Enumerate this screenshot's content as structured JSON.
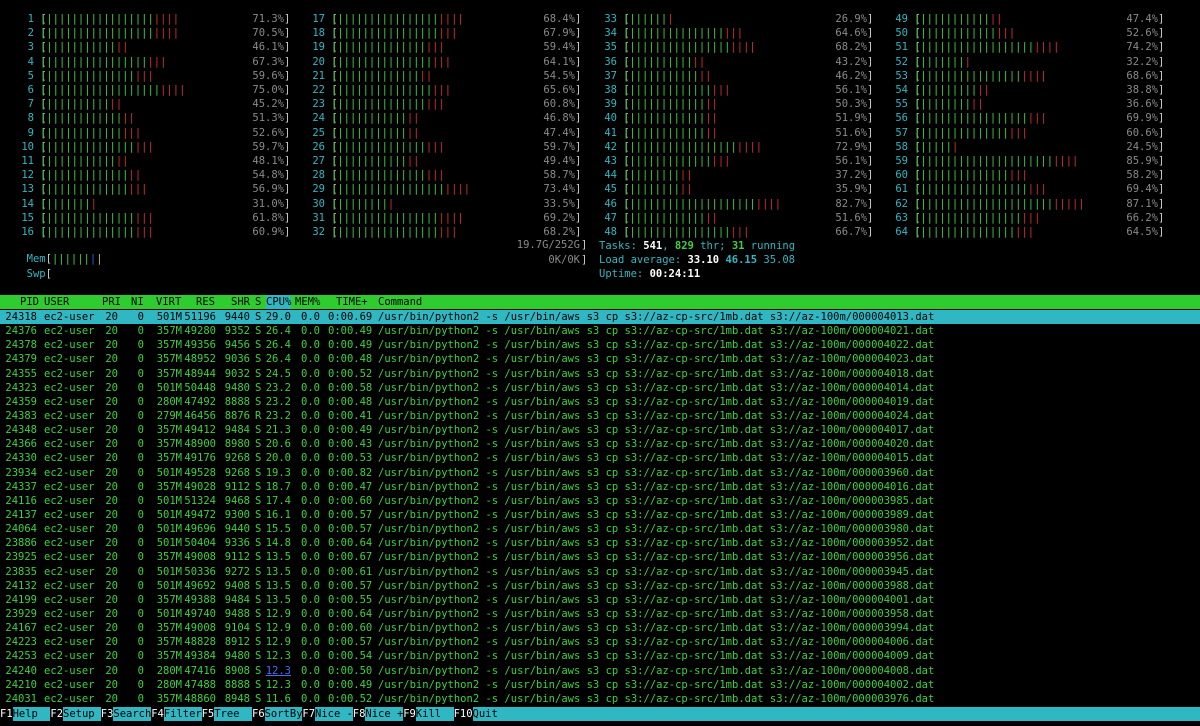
{
  "cpus": [
    {
      "id": "1",
      "pct": "71.3%",
      "g": 18,
      "r": 4
    },
    {
      "id": "2",
      "pct": "70.5%",
      "g": 18,
      "r": 4
    },
    {
      "id": "3",
      "pct": "46.1%",
      "g": 12,
      "r": 2
    },
    {
      "id": "4",
      "pct": "67.3%",
      "g": 17,
      "r": 3
    },
    {
      "id": "5",
      "pct": "59.6%",
      "g": 15,
      "r": 3
    },
    {
      "id": "6",
      "pct": "75.0%",
      "g": 19,
      "r": 4
    },
    {
      "id": "7",
      "pct": "45.2%",
      "g": 11,
      "r": 2
    },
    {
      "id": "8",
      "pct": "51.3%",
      "g": 13,
      "r": 2
    },
    {
      "id": "9",
      "pct": "52.6%",
      "g": 13,
      "r": 3
    },
    {
      "id": "10",
      "pct": "59.7%",
      "g": 15,
      "r": 3
    },
    {
      "id": "11",
      "pct": "48.1%",
      "g": 12,
      "r": 2
    },
    {
      "id": "12",
      "pct": "54.8%",
      "g": 14,
      "r": 2
    },
    {
      "id": "13",
      "pct": "56.9%",
      "g": 14,
      "r": 3
    },
    {
      "id": "14",
      "pct": "31.0%",
      "g": 8,
      "r": 1
    },
    {
      "id": "15",
      "pct": "61.8%",
      "g": 15,
      "r": 3
    },
    {
      "id": "16",
      "pct": "60.9%",
      "g": 15,
      "r": 3
    },
    {
      "id": "17",
      "pct": "68.4%",
      "g": 17,
      "r": 4
    },
    {
      "id": "18",
      "pct": "67.9%",
      "g": 17,
      "r": 3
    },
    {
      "id": "19",
      "pct": "59.4%",
      "g": 15,
      "r": 3
    },
    {
      "id": "20",
      "pct": "64.1%",
      "g": 16,
      "r": 3
    },
    {
      "id": "21",
      "pct": "54.5%",
      "g": 14,
      "r": 2
    },
    {
      "id": "22",
      "pct": "65.6%",
      "g": 16,
      "r": 3
    },
    {
      "id": "23",
      "pct": "60.8%",
      "g": 15,
      "r": 3
    },
    {
      "id": "24",
      "pct": "46.8%",
      "g": 12,
      "r": 2
    },
    {
      "id": "25",
      "pct": "47.4%",
      "g": 12,
      "r": 2
    },
    {
      "id": "26",
      "pct": "59.7%",
      "g": 15,
      "r": 3
    },
    {
      "id": "27",
      "pct": "49.4%",
      "g": 12,
      "r": 2
    },
    {
      "id": "28",
      "pct": "58.7%",
      "g": 15,
      "r": 3
    },
    {
      "id": "29",
      "pct": "73.4%",
      "g": 18,
      "r": 4
    },
    {
      "id": "30",
      "pct": "33.5%",
      "g": 9,
      "r": 1
    },
    {
      "id": "31",
      "pct": "69.2%",
      "g": 17,
      "r": 4
    },
    {
      "id": "32",
      "pct": "68.2%",
      "g": 17,
      "r": 3
    },
    {
      "id": "33",
      "pct": "26.9%",
      "g": 7,
      "r": 1
    },
    {
      "id": "34",
      "pct": "64.6%",
      "g": 16,
      "r": 3
    },
    {
      "id": "35",
      "pct": "68.2%",
      "g": 17,
      "r": 4
    },
    {
      "id": "36",
      "pct": "43.2%",
      "g": 11,
      "r": 2
    },
    {
      "id": "37",
      "pct": "46.2%",
      "g": 12,
      "r": 2
    },
    {
      "id": "38",
      "pct": "56.1%",
      "g": 14,
      "r": 3
    },
    {
      "id": "39",
      "pct": "50.3%",
      "g": 13,
      "r": 2
    },
    {
      "id": "40",
      "pct": "51.9%",
      "g": 13,
      "r": 2
    },
    {
      "id": "41",
      "pct": "51.6%",
      "g": 13,
      "r": 2
    },
    {
      "id": "42",
      "pct": "72.9%",
      "g": 18,
      "r": 4
    },
    {
      "id": "43",
      "pct": "56.1%",
      "g": 14,
      "r": 3
    },
    {
      "id": "44",
      "pct": "37.2%",
      "g": 9,
      "r": 2
    },
    {
      "id": "45",
      "pct": "35.9%",
      "g": 9,
      "r": 2
    },
    {
      "id": "46",
      "pct": "82.7%",
      "g": 21,
      "r": 4
    },
    {
      "id": "47",
      "pct": "51.6%",
      "g": 13,
      "r": 2
    },
    {
      "id": "48",
      "pct": "66.7%",
      "g": 17,
      "r": 3
    },
    {
      "id": "49",
      "pct": "47.4%",
      "g": 12,
      "r": 2
    },
    {
      "id": "50",
      "pct": "52.6%",
      "g": 13,
      "r": 3
    },
    {
      "id": "51",
      "pct": "74.2%",
      "g": 19,
      "r": 4
    },
    {
      "id": "52",
      "pct": "32.2%",
      "g": 8,
      "r": 1
    },
    {
      "id": "53",
      "pct": "68.6%",
      "g": 17,
      "r": 4
    },
    {
      "id": "54",
      "pct": "38.8%",
      "g": 10,
      "r": 2
    },
    {
      "id": "55",
      "pct": "36.6%",
      "g": 9,
      "r": 2
    },
    {
      "id": "56",
      "pct": "69.9%",
      "g": 18,
      "r": 3
    },
    {
      "id": "57",
      "pct": "60.6%",
      "g": 15,
      "r": 3
    },
    {
      "id": "58",
      "pct": "24.5%",
      "g": 6,
      "r": 1
    },
    {
      "id": "59",
      "pct": "85.9%",
      "g": 22,
      "r": 4
    },
    {
      "id": "60",
      "pct": "58.2%",
      "g": 15,
      "r": 3
    },
    {
      "id": "61",
      "pct": "69.4%",
      "g": 18,
      "r": 3
    },
    {
      "id": "62",
      "pct": "87.1%",
      "g": 22,
      "r": 5
    },
    {
      "id": "63",
      "pct": "66.2%",
      "g": 17,
      "r": 3
    },
    {
      "id": "64",
      "pct": "64.5%",
      "g": 16,
      "r": 3
    }
  ],
  "mem": {
    "label": "Mem",
    "value": "19.7G/252G"
  },
  "swp": {
    "label": "Swp",
    "value": "0K/0K"
  },
  "tasks": {
    "label": "Tasks:",
    "count": "541",
    "sep": ",",
    "thr": "829",
    "thr_label": "thr;",
    "running": "31",
    "running_label": "running"
  },
  "load": {
    "label": "Load average:",
    "l1": "33.10",
    "l5": "46.15",
    "l15": "35.08"
  },
  "uptime": {
    "label": "Uptime:",
    "value": "00:24:11"
  },
  "columns": {
    "pid": "PID",
    "user": "USER",
    "pri": "PRI",
    "ni": "NI",
    "virt": "VIRT",
    "res": "RES",
    "shr": "SHR",
    "s": "S",
    "cpu": "CPU%",
    "mem": "MEM%",
    "time": "TIME+",
    "cmd": "Command"
  },
  "processes": [
    {
      "pid": "24318",
      "user": "ec2-user",
      "pri": "20",
      "ni": "0",
      "virt": "501M",
      "res": "51196",
      "shr": "9440",
      "s": "S",
      "cpu": "29.0",
      "mem": "0.0",
      "time": "0:00.69",
      "cmd": "/usr/bin/python2 -s /usr/bin/aws s3 cp s3://az-cp-src/1mb.dat s3://az-100m/000004013.dat"
    },
    {
      "pid": "24376",
      "user": "ec2-user",
      "pri": "20",
      "ni": "0",
      "virt": "357M",
      "res": "49280",
      "shr": "9352",
      "s": "S",
      "cpu": "26.4",
      "mem": "0.0",
      "time": "0:00.49",
      "cmd": "/usr/bin/python2 -s /usr/bin/aws s3 cp s3://az-cp-src/1mb.dat s3://az-100m/000004021.dat"
    },
    {
      "pid": "24378",
      "user": "ec2-user",
      "pri": "20",
      "ni": "0",
      "virt": "357M",
      "res": "49356",
      "shr": "9456",
      "s": "S",
      "cpu": "26.4",
      "mem": "0.0",
      "time": "0:00.49",
      "cmd": "/usr/bin/python2 -s /usr/bin/aws s3 cp s3://az-cp-src/1mb.dat s3://az-100m/000004022.dat"
    },
    {
      "pid": "24379",
      "user": "ec2-user",
      "pri": "20",
      "ni": "0",
      "virt": "357M",
      "res": "48952",
      "shr": "9036",
      "s": "S",
      "cpu": "26.4",
      "mem": "0.0",
      "time": "0:00.48",
      "cmd": "/usr/bin/python2 -s /usr/bin/aws s3 cp s3://az-cp-src/1mb.dat s3://az-100m/000004023.dat"
    },
    {
      "pid": "24355",
      "user": "ec2-user",
      "pri": "20",
      "ni": "0",
      "virt": "357M",
      "res": "48944",
      "shr": "9032",
      "s": "S",
      "cpu": "24.5",
      "mem": "0.0",
      "time": "0:00.52",
      "cmd": "/usr/bin/python2 -s /usr/bin/aws s3 cp s3://az-cp-src/1mb.dat s3://az-100m/000004018.dat"
    },
    {
      "pid": "24323",
      "user": "ec2-user",
      "pri": "20",
      "ni": "0",
      "virt": "501M",
      "res": "50448",
      "shr": "9480",
      "s": "S",
      "cpu": "23.2",
      "mem": "0.0",
      "time": "0:00.58",
      "cmd": "/usr/bin/python2 -s /usr/bin/aws s3 cp s3://az-cp-src/1mb.dat s3://az-100m/000004014.dat"
    },
    {
      "pid": "24359",
      "user": "ec2-user",
      "pri": "20",
      "ni": "0",
      "virt": "280M",
      "res": "47492",
      "shr": "8888",
      "s": "S",
      "cpu": "23.2",
      "mem": "0.0",
      "time": "0:00.48",
      "cmd": "/usr/bin/python2 -s /usr/bin/aws s3 cp s3://az-cp-src/1mb.dat s3://az-100m/000004019.dat"
    },
    {
      "pid": "24383",
      "user": "ec2-user",
      "pri": "20",
      "ni": "0",
      "virt": "279M",
      "res": "46456",
      "shr": "8876",
      "s": "R",
      "cpu": "23.2",
      "mem": "0.0",
      "time": "0:00.41",
      "cmd": "/usr/bin/python2 -s /usr/bin/aws s3 cp s3://az-cp-src/1mb.dat s3://az-100m/000004024.dat"
    },
    {
      "pid": "24348",
      "user": "ec2-user",
      "pri": "20",
      "ni": "0",
      "virt": "357M",
      "res": "49412",
      "shr": "9484",
      "s": "S",
      "cpu": "21.3",
      "mem": "0.0",
      "time": "0:00.49",
      "cmd": "/usr/bin/python2 -s /usr/bin/aws s3 cp s3://az-cp-src/1mb.dat s3://az-100m/000004017.dat"
    },
    {
      "pid": "24366",
      "user": "ec2-user",
      "pri": "20",
      "ni": "0",
      "virt": "357M",
      "res": "48900",
      "shr": "8980",
      "s": "S",
      "cpu": "20.6",
      "mem": "0.0",
      "time": "0:00.43",
      "cmd": "/usr/bin/python2 -s /usr/bin/aws s3 cp s3://az-cp-src/1mb.dat s3://az-100m/000004020.dat"
    },
    {
      "pid": "24330",
      "user": "ec2-user",
      "pri": "20",
      "ni": "0",
      "virt": "357M",
      "res": "49176",
      "shr": "9268",
      "s": "S",
      "cpu": "20.0",
      "mem": "0.0",
      "time": "0:00.53",
      "cmd": "/usr/bin/python2 -s /usr/bin/aws s3 cp s3://az-cp-src/1mb.dat s3://az-100m/000004015.dat"
    },
    {
      "pid": "23934",
      "user": "ec2-user",
      "pri": "20",
      "ni": "0",
      "virt": "501M",
      "res": "49528",
      "shr": "9268",
      "s": "S",
      "cpu": "19.3",
      "mem": "0.0",
      "time": "0:00.82",
      "cmd": "/usr/bin/python2 -s /usr/bin/aws s3 cp s3://az-cp-src/1mb.dat s3://az-100m/000003960.dat"
    },
    {
      "pid": "24337",
      "user": "ec2-user",
      "pri": "20",
      "ni": "0",
      "virt": "357M",
      "res": "49028",
      "shr": "9112",
      "s": "S",
      "cpu": "18.7",
      "mem": "0.0",
      "time": "0:00.47",
      "cmd": "/usr/bin/python2 -s /usr/bin/aws s3 cp s3://az-cp-src/1mb.dat s3://az-100m/000004016.dat"
    },
    {
      "pid": "24116",
      "user": "ec2-user",
      "pri": "20",
      "ni": "0",
      "virt": "501M",
      "res": "51324",
      "shr": "9468",
      "s": "S",
      "cpu": "17.4",
      "mem": "0.0",
      "time": "0:00.60",
      "cmd": "/usr/bin/python2 -s /usr/bin/aws s3 cp s3://az-cp-src/1mb.dat s3://az-100m/000003985.dat"
    },
    {
      "pid": "24137",
      "user": "ec2-user",
      "pri": "20",
      "ni": "0",
      "virt": "501M",
      "res": "49472",
      "shr": "9300",
      "s": "S",
      "cpu": "16.1",
      "mem": "0.0",
      "time": "0:00.57",
      "cmd": "/usr/bin/python2 -s /usr/bin/aws s3 cp s3://az-cp-src/1mb.dat s3://az-100m/000003989.dat"
    },
    {
      "pid": "24064",
      "user": "ec2-user",
      "pri": "20",
      "ni": "0",
      "virt": "501M",
      "res": "49696",
      "shr": "9440",
      "s": "S",
      "cpu": "15.5",
      "mem": "0.0",
      "time": "0:00.57",
      "cmd": "/usr/bin/python2 -s /usr/bin/aws s3 cp s3://az-cp-src/1mb.dat s3://az-100m/000003980.dat"
    },
    {
      "pid": "23886",
      "user": "ec2-user",
      "pri": "20",
      "ni": "0",
      "virt": "501M",
      "res": "50404",
      "shr": "9336",
      "s": "S",
      "cpu": "14.8",
      "mem": "0.0",
      "time": "0:00.64",
      "cmd": "/usr/bin/python2 -s /usr/bin/aws s3 cp s3://az-cp-src/1mb.dat s3://az-100m/000003952.dat"
    },
    {
      "pid": "23925",
      "user": "ec2-user",
      "pri": "20",
      "ni": "0",
      "virt": "357M",
      "res": "49008",
      "shr": "9112",
      "s": "S",
      "cpu": "13.5",
      "mem": "0.0",
      "time": "0:00.67",
      "cmd": "/usr/bin/python2 -s /usr/bin/aws s3 cp s3://az-cp-src/1mb.dat s3://az-100m/000003956.dat"
    },
    {
      "pid": "23835",
      "user": "ec2-user",
      "pri": "20",
      "ni": "0",
      "virt": "501M",
      "res": "50336",
      "shr": "9272",
      "s": "S",
      "cpu": "13.5",
      "mem": "0.0",
      "time": "0:00.61",
      "cmd": "/usr/bin/python2 -s /usr/bin/aws s3 cp s3://az-cp-src/1mb.dat s3://az-100m/000003945.dat"
    },
    {
      "pid": "24132",
      "user": "ec2-user",
      "pri": "20",
      "ni": "0",
      "virt": "501M",
      "res": "49692",
      "shr": "9408",
      "s": "S",
      "cpu": "13.5",
      "mem": "0.0",
      "time": "0:00.57",
      "cmd": "/usr/bin/python2 -s /usr/bin/aws s3 cp s3://az-cp-src/1mb.dat s3://az-100m/000003988.dat"
    },
    {
      "pid": "24199",
      "user": "ec2-user",
      "pri": "20",
      "ni": "0",
      "virt": "357M",
      "res": "49388",
      "shr": "9484",
      "s": "S",
      "cpu": "13.5",
      "mem": "0.0",
      "time": "0:00.55",
      "cmd": "/usr/bin/python2 -s /usr/bin/aws s3 cp s3://az-cp-src/1mb.dat s3://az-100m/000004001.dat"
    },
    {
      "pid": "23929",
      "user": "ec2-user",
      "pri": "20",
      "ni": "0",
      "virt": "501M",
      "res": "49740",
      "shr": "9488",
      "s": "S",
      "cpu": "12.9",
      "mem": "0.0",
      "time": "0:00.64",
      "cmd": "/usr/bin/python2 -s /usr/bin/aws s3 cp s3://az-cp-src/1mb.dat s3://az-100m/000003958.dat"
    },
    {
      "pid": "24167",
      "user": "ec2-user",
      "pri": "20",
      "ni": "0",
      "virt": "357M",
      "res": "49008",
      "shr": "9104",
      "s": "S",
      "cpu": "12.9",
      "mem": "0.0",
      "time": "0:00.60",
      "cmd": "/usr/bin/python2 -s /usr/bin/aws s3 cp s3://az-cp-src/1mb.dat s3://az-100m/000003994.dat"
    },
    {
      "pid": "24223",
      "user": "ec2-user",
      "pri": "20",
      "ni": "0",
      "virt": "357M",
      "res": "48828",
      "shr": "8912",
      "s": "S",
      "cpu": "12.9",
      "mem": "0.0",
      "time": "0:00.57",
      "cmd": "/usr/bin/python2 -s /usr/bin/aws s3 cp s3://az-cp-src/1mb.dat s3://az-100m/000004006.dat"
    },
    {
      "pid": "24253",
      "user": "ec2-user",
      "pri": "20",
      "ni": "0",
      "virt": "357M",
      "res": "49384",
      "shr": "9480",
      "s": "S",
      "cpu": "12.3",
      "mem": "0.0",
      "time": "0:00.54",
      "cmd": "/usr/bin/python2 -s /usr/bin/aws s3 cp s3://az-cp-src/1mb.dat s3://az-100m/000004009.dat"
    },
    {
      "pid": "24240",
      "user": "ec2-user",
      "pri": "20",
      "ni": "0",
      "virt": "280M",
      "res": "47416",
      "shr": "8908",
      "s": "S",
      "cpu": "12.3",
      "mem": "0.0",
      "time": "0:00.50",
      "cmd": "/usr/bin/python2 -s /usr/bin/aws s3 cp s3://az-cp-src/1mb.dat s3://az-100m/000004008.dat",
      "cpu_link": true
    },
    {
      "pid": "24210",
      "user": "ec2-user",
      "pri": "20",
      "ni": "0",
      "virt": "280M",
      "res": "47488",
      "shr": "8888",
      "s": "S",
      "cpu": "12.3",
      "mem": "0.0",
      "time": "0:00.49",
      "cmd": "/usr/bin/python2 -s /usr/bin/aws s3 cp s3://az-cp-src/1mb.dat s3://az-100m/000004002.dat"
    },
    {
      "pid": "24031",
      "user": "ec2-user",
      "pri": "20",
      "ni": "0",
      "virt": "357M",
      "res": "48860",
      "shr": "8948",
      "s": "S",
      "cpu": "11.6",
      "mem": "0.0",
      "time": "0:00.52",
      "cmd": "/usr/bin/python2 -s /usr/bin/aws s3 cp s3://az-cp-src/1mb.dat s3://az-100m/000003976.dat"
    }
  ],
  "footer": [
    {
      "key": "F1",
      "label": "Help  "
    },
    {
      "key": "F2",
      "label": "Setup "
    },
    {
      "key": "F3",
      "label": "Search"
    },
    {
      "key": "F4",
      "label": "Filter"
    },
    {
      "key": "F5",
      "label": "Tree  "
    },
    {
      "key": "F6",
      "label": "SortBy"
    },
    {
      "key": "F7",
      "label": "Nice -"
    },
    {
      "key": "F8",
      "label": "Nice +"
    },
    {
      "key": "F9",
      "label": "Kill  "
    },
    {
      "key": "F10",
      "label": "Quit  "
    }
  ]
}
